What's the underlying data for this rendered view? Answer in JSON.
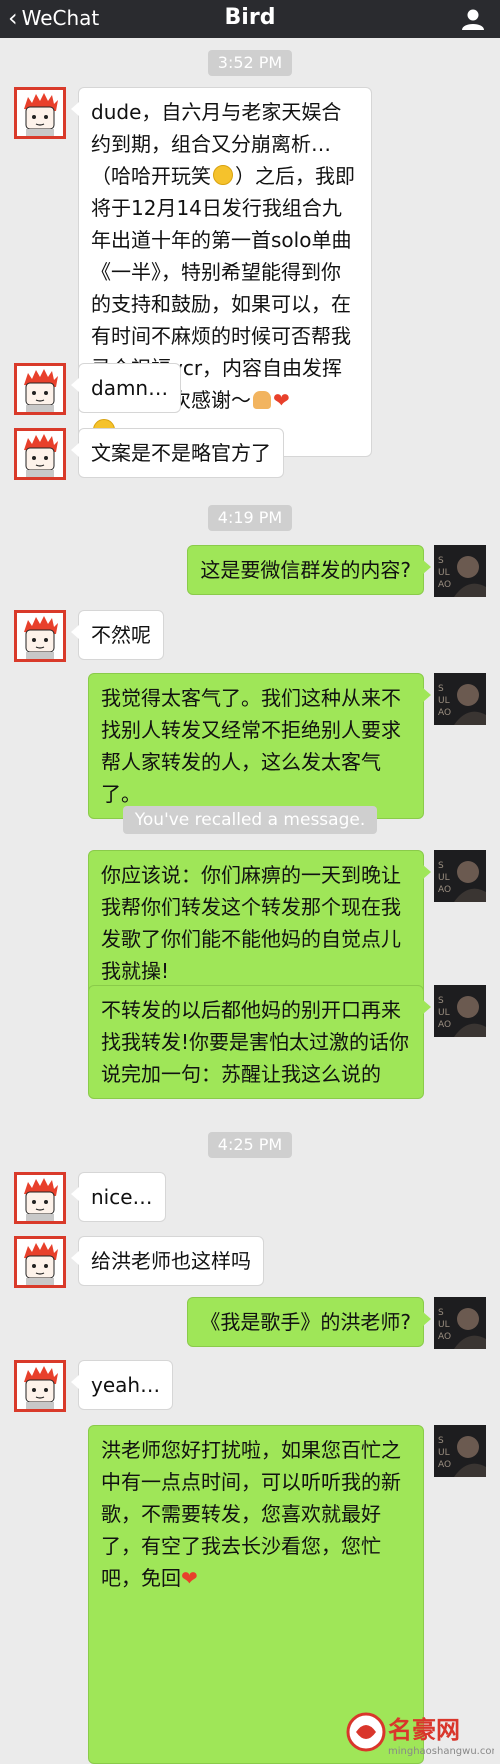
{
  "header": {
    "back_label": "WeChat",
    "title": "Bird"
  },
  "messages": {
    "t1": "3:52 PM",
    "m1": "dude，自六月与老家天娱合约到期，组合又分崩离析…（哈哈开玩笑",
    "m1_tail": "）之后，我即将于12月14日发行我组合九年出道十年的第一首solo单曲《一半》，特别希望能得到你的支持和鼓励，如果可以，在有时间不麻烦的时候可否帮我录个祝福vcr，内容自由发挥就好，再次感谢～",
    "m2": "damn…",
    "m3": "文案是不是略官方了",
    "t2": "4:19 PM",
    "m4": "这是要微信群发的内容?",
    "m5": "不然呢",
    "m6": "我觉得太客气了。我们这种从来不找别人转发又经常不拒绝别人要求帮人家转发的人，这么发太客气了。",
    "recalled": "You've recalled a message.",
    "m7": "你应该说：你们麻痹的一天到晚让我帮你们转发这个转发那个现在我发歌了你们能不能他妈的自觉点儿我就操!",
    "m8": "不转发的以后都他妈的别开口再来找我转发!你要是害怕太过激的话你说完加一句：苏醒让我这么说的",
    "t3": "4:25 PM",
    "m9": "nice…",
    "m10": "给洪老师也这样吗",
    "m11": "《我是歌手》的洪老师?",
    "m12": "yeah…",
    "m13": "洪老师您好打扰啦，如果您百忙之中有一点点时间，可以听听我的新歌，不需要转发，您喜欢就最好了，有空了我去长沙看您，您忙吧，免回"
  },
  "watermark": {
    "text": "名豪网",
    "url": "minghaoshangwu.com"
  },
  "colors": {
    "header_bg": "#2a2b2f",
    "chat_bg": "#ebebeb",
    "outgoing_bubble": "#9fe658",
    "incoming_bubble": "#ffffff"
  },
  "icons": [
    "chevron-left-icon",
    "user-icon",
    "cartoon-avatar",
    "album-avatar",
    "grin-emoji",
    "pray-emoji",
    "heart-emoji"
  ]
}
